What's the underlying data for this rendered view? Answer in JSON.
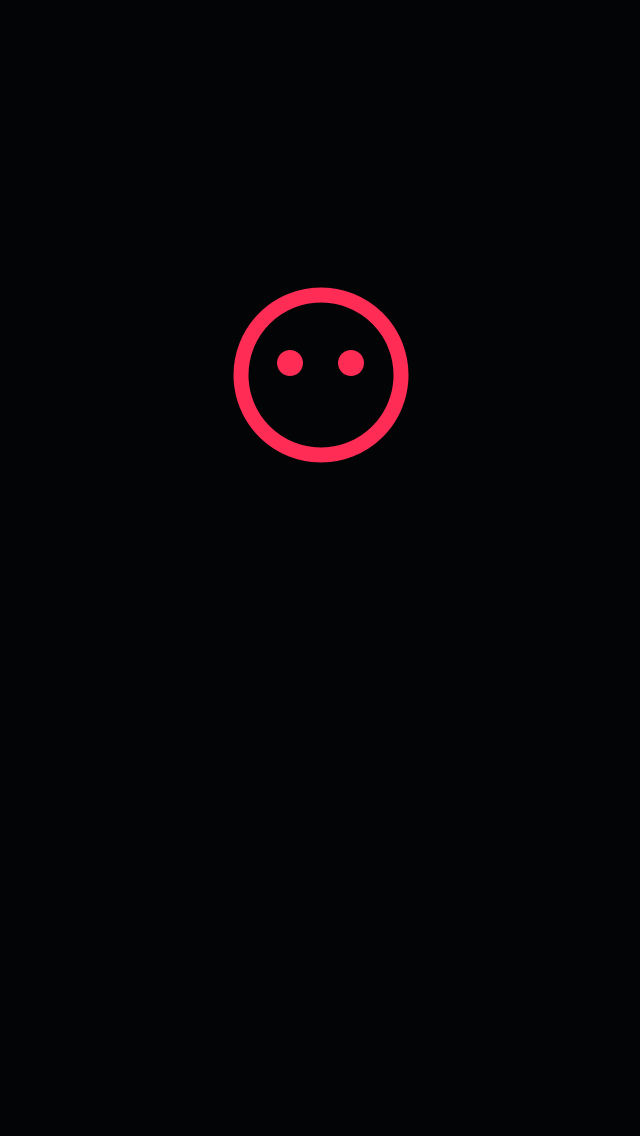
{
  "screen": {
    "background_color": "#030406"
  },
  "face_icon": {
    "icon": "neutral-face-icon",
    "color": "#ff2d55"
  }
}
